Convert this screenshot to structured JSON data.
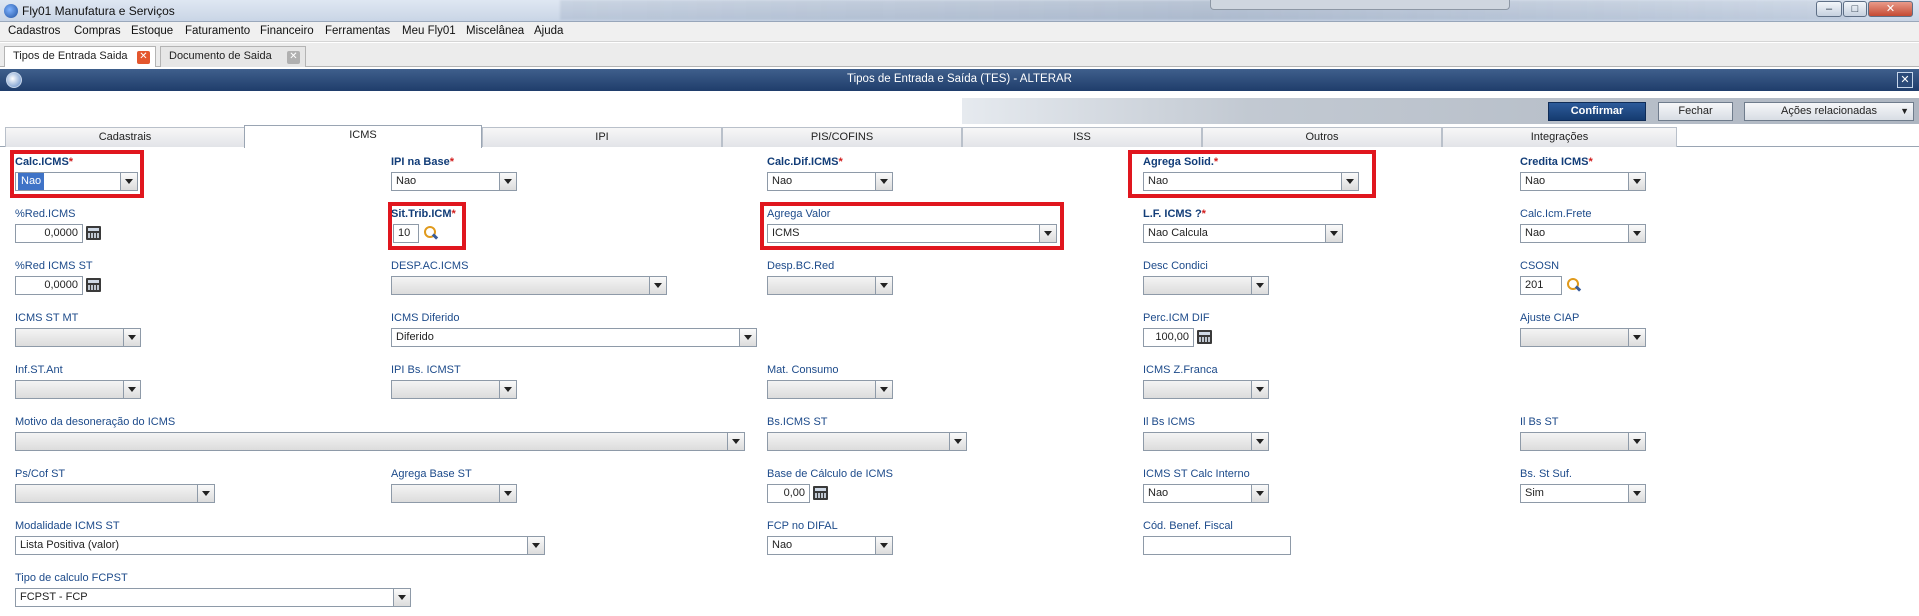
{
  "window": {
    "title": "Fly01 Manufatura e Serviços",
    "buttons": [
      "–",
      "□",
      "✕"
    ]
  },
  "menu": [
    "Cadastros",
    "Compras",
    "Estoque",
    "Faturamento",
    "Financeiro",
    "Ferramentas",
    "Meu Fly01",
    "Miscelânea",
    "Ajuda"
  ],
  "doc_tabs": [
    {
      "label": "Tipos de Entrada Saida"
    },
    {
      "label": "Documento de Saida"
    }
  ],
  "dialog": {
    "title": "Tipos de Entrada e Saída (TES) - ALTERAR",
    "close": "✕"
  },
  "actions": {
    "confirm": "Confirmar",
    "close": "Fechar",
    "related": "Ações relacionadas",
    "related_caret": "▼"
  },
  "section_tabs": [
    "Cadastrais",
    "ICMS",
    "IPI",
    "PIS/COFINS",
    "ISS",
    "Outros",
    "Integrações"
  ],
  "fields": {
    "calc_icms": {
      "label": "Calc.ICMS",
      "value": "Nao"
    },
    "ipi_na_base": {
      "label": "IPI na Base",
      "value": "Nao"
    },
    "calc_dif_icms": {
      "label": "Calc.Dif.ICMS",
      "value": "Nao"
    },
    "agrega_solid": {
      "label": "Agrega Solid.",
      "value": "Nao"
    },
    "credita_icms": {
      "label": "Credita ICMS",
      "value": "Nao"
    },
    "red_icms": {
      "label": "%Red.ICMS",
      "value": "0,0000"
    },
    "sit_trib_icm": {
      "label": "Sit.Trib.ICM",
      "value": "10"
    },
    "agrega_valor": {
      "label": "Agrega Valor",
      "value": "ICMS"
    },
    "lf_icms": {
      "label": "L.F. ICMS ?",
      "value": "Nao Calcula"
    },
    "calc_icm_frete": {
      "label": "Calc.Icm.Frete",
      "value": "Nao"
    },
    "red_icms_st": {
      "label": "%Red ICMS ST",
      "value": "0,0000"
    },
    "desp_ac_icms": {
      "label": "DESP.AC.ICMS",
      "value": ""
    },
    "desp_bc_red": {
      "label": "Desp.BC.Red",
      "value": ""
    },
    "desc_condici": {
      "label": "Desc Condici",
      "value": ""
    },
    "csosn": {
      "label": "CSOSN",
      "value": "201"
    },
    "icms_st_mt": {
      "label": "ICMS ST MT",
      "value": ""
    },
    "icms_diferido": {
      "label": "ICMS Diferido",
      "value": "Diferido"
    },
    "perc_icm_dif": {
      "label": "Perc.ICM DIF",
      "value": "100,00"
    },
    "ajuste_ciap": {
      "label": "Ajuste CIAP",
      "value": ""
    },
    "inf_st_ant": {
      "label": "Inf.ST.Ant",
      "value": ""
    },
    "ipi_bs_icmst": {
      "label": "IPI Bs. ICMST",
      "value": ""
    },
    "mat_consumo": {
      "label": "Mat. Consumo",
      "value": ""
    },
    "icms_z_franca": {
      "label": "ICMS Z.Franca",
      "value": ""
    },
    "motivo_desoneracao": {
      "label": "Motivo da desoneração do ICMS",
      "value": ""
    },
    "bs_icms_st": {
      "label": "Bs.ICMS ST",
      "value": ""
    },
    "ii_bs_icms": {
      "label": "Il Bs ICMS",
      "value": ""
    },
    "ii_bs_st": {
      "label": "Il Bs ST",
      "value": ""
    },
    "ps_cof_st": {
      "label": "Ps/Cof ST",
      "value": ""
    },
    "agrega_base_st": {
      "label": "Agrega Base ST",
      "value": ""
    },
    "base_calculo_icms": {
      "label": "Base de Cálculo de ICMS",
      "value": "0,00"
    },
    "icms_st_calc_interno": {
      "label": "ICMS ST Calc Interno",
      "value": "Nao"
    },
    "bs_st_suf": {
      "label": "Bs. St Suf.",
      "value": "Sim"
    },
    "modalidade_icms_st": {
      "label": "Modalidade ICMS ST",
      "value": "Lista Positiva (valor)"
    },
    "fcp_no_difal": {
      "label": "FCP no DIFAL",
      "value": "Nao"
    },
    "cod_benef_fiscal": {
      "label": "Cód. Benef. Fiscal",
      "value": ""
    },
    "tipo_calculo_fcpst": {
      "label": "Tipo de calculo FCPST",
      "value": "FCPST -  FCP"
    }
  },
  "required_marker": "*",
  "highlight_color": "#e0161e"
}
